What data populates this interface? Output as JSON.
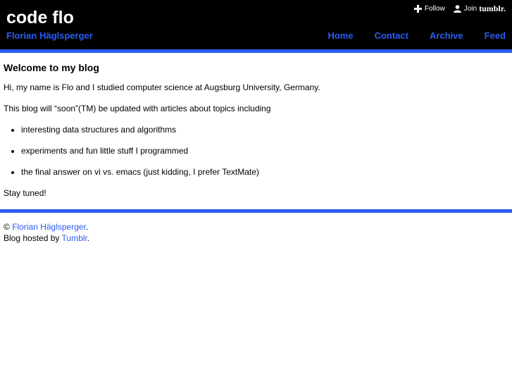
{
  "header": {
    "title": "code flo",
    "subtitle": "Florian Häglsperger",
    "tumblr_controls": {
      "follow_label": "Follow",
      "join_label": "Join",
      "brand": "tumblr."
    },
    "nav": [
      {
        "label": "Home"
      },
      {
        "label": "Contact"
      },
      {
        "label": "Archive"
      },
      {
        "label": "Feed"
      }
    ]
  },
  "post": {
    "title": "Welcome to my blog",
    "intro": "Hi, my name is Flo and I studied computer science at Augsburg University, Germany.",
    "lead": "This blog will “soon”(TM) be updated with articles about topics including",
    "topics": [
      "interesting data structures and algorithms",
      "experiments and fun little stuff I programmed",
      "the final answer on vi vs. emacs (just kidding, I prefer TextMate)"
    ],
    "closing": "Stay tuned!"
  },
  "footer": {
    "copyright_symbol": "©",
    "author_link": "Florian Häglsperger",
    "hosted_prefix": "Blog hosted by",
    "host_link": "Tumblr"
  },
  "colors": {
    "header_bg": "#000000",
    "accent": "#2a5cf5",
    "text": "#000000"
  },
  "icons": {
    "follow": "plus-icon",
    "join": "person-icon"
  }
}
